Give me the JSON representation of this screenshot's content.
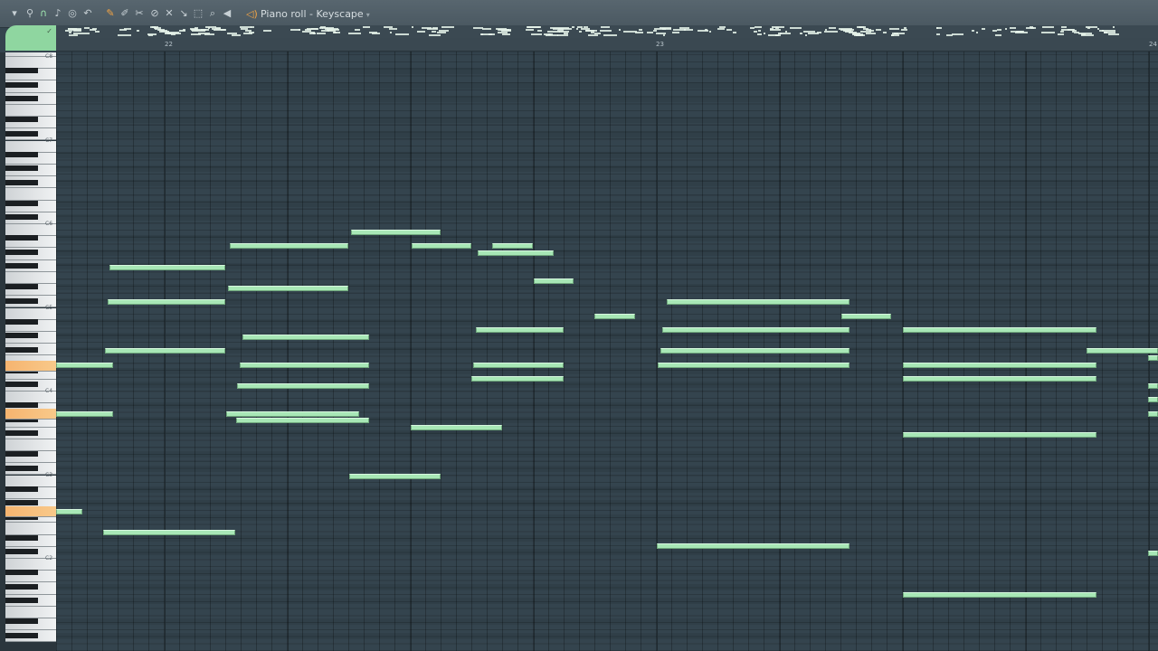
{
  "window": {
    "title": "Piano roll - Keyscape",
    "title_caret": "▾"
  },
  "toolbar": {
    "icons": [
      "menu-arrow",
      "magnet",
      "headphones",
      "note",
      "stamp",
      "undo",
      "pencil",
      "paint",
      "erase",
      "mute",
      "slice",
      "select",
      "zoom",
      "speaker"
    ]
  },
  "ruler": {
    "bars": [
      "22",
      "23",
      "24"
    ]
  },
  "keyboard": {
    "octave_labels": [
      "C8",
      "C7",
      "C6",
      "C5",
      "C4",
      "C3",
      "C2"
    ]
  },
  "colors": {
    "note": "#a8e7b6",
    "grid": "#34444e",
    "accent": "#f2a445",
    "highlight_key": "#f6b46f"
  }
}
